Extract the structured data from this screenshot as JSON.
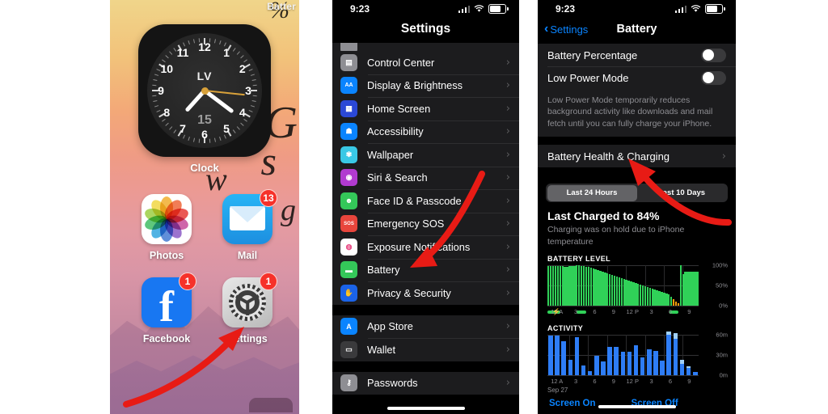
{
  "home_screen": {
    "overlay_text": "Batter",
    "widget": {
      "name": "clock-widget",
      "label": "Clock",
      "brand": "LV",
      "date": "15",
      "numerals": [
        "12",
        "1",
        "2",
        "3",
        "4",
        "5",
        "6",
        "7",
        "8",
        "9",
        "10",
        "11"
      ]
    },
    "apps": [
      {
        "name": "Photos",
        "badge": null,
        "icon": "photos-icon"
      },
      {
        "name": "Mail",
        "badge": "13",
        "icon": "mail-icon"
      },
      {
        "name": "Facebook",
        "badge": "1",
        "icon": "facebook-icon"
      },
      {
        "name": "Settings",
        "badge": "1",
        "icon": "settings-gear-icon"
      }
    ]
  },
  "settings_screen": {
    "status_bar": {
      "time": "9:23",
      "cellular": "signal-bars-icon",
      "wifi": "wifi-icon",
      "battery": "battery-icon"
    },
    "title": "Settings",
    "groups": [
      {
        "items": [
          {
            "label": "Control Center",
            "icon": "control-center-icon",
            "color": "#8e8e93"
          },
          {
            "label": "Display & Brightness",
            "icon": "display-brightness-icon",
            "color": "#0a84ff"
          },
          {
            "label": "Home Screen",
            "icon": "home-screen-icon",
            "color": "#2b48d6"
          },
          {
            "label": "Accessibility",
            "icon": "accessibility-icon",
            "color": "#0a84ff"
          },
          {
            "label": "Wallpaper",
            "icon": "wallpaper-icon",
            "color": "#39c8e6"
          },
          {
            "label": "Siri & Search",
            "icon": "siri-icon",
            "color": "#b13ad0"
          },
          {
            "label": "Face ID & Passcode",
            "icon": "face-id-icon",
            "color": "#34c759"
          },
          {
            "label": "Emergency SOS",
            "icon": "emergency-sos-icon",
            "color": "#e8453c"
          },
          {
            "label": "Exposure Notifications",
            "icon": "exposure-notifications-icon",
            "color": "#ffffff"
          },
          {
            "label": "Battery",
            "icon": "battery-green-icon",
            "color": "#34c759"
          },
          {
            "label": "Privacy & Security",
            "icon": "privacy-security-icon",
            "color": "#1b63e8"
          }
        ]
      },
      {
        "items": [
          {
            "label": "App Store",
            "icon": "app-store-icon",
            "color": "#0a84ff"
          },
          {
            "label": "Wallet",
            "icon": "wallet-icon",
            "color": "#3a3a3c"
          }
        ]
      },
      {
        "items": [
          {
            "label": "Passwords",
            "icon": "passwords-key-icon",
            "color": "#8e8e93"
          }
        ]
      }
    ]
  },
  "battery_screen": {
    "status_bar": {
      "time": "9:23"
    },
    "back_label": "Settings",
    "title": "Battery",
    "toggles": [
      {
        "label": "Battery Percentage",
        "on": false
      },
      {
        "label": "Low Power Mode",
        "on": false
      }
    ],
    "footer_note": "Low Power Mode temporarily reduces background activity like downloads and mail fetch until you can fully charge your iPhone.",
    "health_row": "Battery Health & Charging",
    "segmented": {
      "options": [
        "Last 24 Hours",
        "Last 10 Days"
      ],
      "selected": "Last 24 Hours"
    },
    "last_charged": "Last Charged to 84%",
    "last_charged_note": "Charging was on hold due to iPhone temperature",
    "date_label": "Sep 27",
    "legend": [
      "Screen On",
      "Screen Off"
    ]
  },
  "chart_data": [
    {
      "type": "area",
      "title": "BATTERY LEVEL",
      "xlabel": "",
      "ylabel": "",
      "ylim": [
        0,
        100
      ],
      "yticks": [
        0,
        50,
        100
      ],
      "ytick_labels": [
        "0%",
        "50%",
        "100%"
      ],
      "x": [
        "12 A",
        "3",
        "6",
        "9",
        "12 P",
        "3",
        "6",
        "9"
      ],
      "xtick_labels": [
        "12 A",
        "3",
        "6",
        "9",
        "12 P",
        "3",
        "6",
        "9"
      ],
      "series": [
        {
          "name": "Battery Level",
          "color": "#30d158",
          "values": [
            97,
            97,
            98,
            98,
            98,
            97,
            97,
            96,
            96,
            97,
            98,
            98,
            99,
            99,
            98,
            97,
            96,
            95,
            93,
            91,
            89,
            87,
            85,
            83,
            81,
            79,
            77,
            75,
            73,
            71,
            69,
            67,
            65,
            63,
            61,
            59,
            57,
            55,
            53,
            51,
            49,
            47,
            45,
            43,
            41,
            39,
            37,
            35,
            33,
            31,
            29,
            27,
            22,
            16,
            10,
            6,
            100,
            78,
            84,
            84,
            84,
            84,
            84,
            84
          ]
        }
      ],
      "charging_periods": [
        {
          "start": 0.0,
          "end": 0.085,
          "bolt": true
        },
        {
          "start": 0.195,
          "end": 0.255,
          "bolt": false
        },
        {
          "start": 0.805,
          "end": 0.865,
          "bolt": false
        }
      ],
      "low_marker_color": "#ff9f0a",
      "grid": true
    },
    {
      "type": "bar",
      "title": "ACTIVITY",
      "xlabel": "",
      "ylabel": "",
      "ylim": [
        0,
        60
      ],
      "yticks": [
        0,
        30,
        60
      ],
      "ytick_labels": [
        "0m",
        "30m",
        "60m"
      ],
      "x": [
        "12 A",
        "3",
        "6",
        "9",
        "12 P",
        "3",
        "6",
        "9"
      ],
      "xtick_labels": [
        "12 A",
        "3",
        "6",
        "9",
        "12 P",
        "3",
        "6",
        "9"
      ],
      "series": [
        {
          "name": "Screen On",
          "color": "#2e7df6",
          "values": [
            58,
            58,
            50,
            22,
            56,
            14,
            6,
            29,
            20,
            42,
            42,
            35,
            34,
            44,
            26,
            38,
            36,
            21,
            60,
            54,
            17,
            10,
            5
          ]
        },
        {
          "name": "Screen Off",
          "color": "#9fd0f8",
          "values": [
            0,
            0,
            0,
            0,
            0,
            0,
            0,
            0,
            0,
            0,
            0,
            0,
            0,
            0,
            0,
            0,
            0,
            0,
            5,
            8,
            5,
            3,
            0
          ]
        }
      ],
      "grid": true
    }
  ]
}
